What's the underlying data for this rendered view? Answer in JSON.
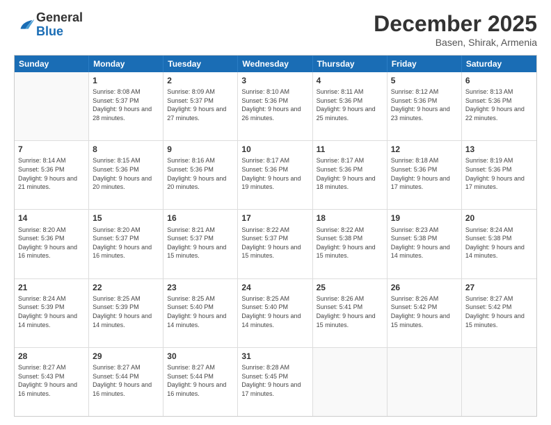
{
  "header": {
    "logo": {
      "general": "General",
      "blue": "Blue"
    },
    "title": "December 2025",
    "subtitle": "Basen, Shirak, Armenia"
  },
  "calendar": {
    "days": [
      "Sunday",
      "Monday",
      "Tuesday",
      "Wednesday",
      "Thursday",
      "Friday",
      "Saturday"
    ],
    "rows": [
      [
        {
          "day": "",
          "empty": true
        },
        {
          "day": "1",
          "sunrise": "8:08 AM",
          "sunset": "5:37 PM",
          "daylight": "9 hours and 28 minutes."
        },
        {
          "day": "2",
          "sunrise": "8:09 AM",
          "sunset": "5:37 PM",
          "daylight": "9 hours and 27 minutes."
        },
        {
          "day": "3",
          "sunrise": "8:10 AM",
          "sunset": "5:36 PM",
          "daylight": "9 hours and 26 minutes."
        },
        {
          "day": "4",
          "sunrise": "8:11 AM",
          "sunset": "5:36 PM",
          "daylight": "9 hours and 25 minutes."
        },
        {
          "day": "5",
          "sunrise": "8:12 AM",
          "sunset": "5:36 PM",
          "daylight": "9 hours and 23 minutes."
        },
        {
          "day": "6",
          "sunrise": "8:13 AM",
          "sunset": "5:36 PM",
          "daylight": "9 hours and 22 minutes."
        }
      ],
      [
        {
          "day": "7",
          "sunrise": "8:14 AM",
          "sunset": "5:36 PM",
          "daylight": "9 hours and 21 minutes."
        },
        {
          "day": "8",
          "sunrise": "8:15 AM",
          "sunset": "5:36 PM",
          "daylight": "9 hours and 20 minutes."
        },
        {
          "day": "9",
          "sunrise": "8:16 AM",
          "sunset": "5:36 PM",
          "daylight": "9 hours and 20 minutes."
        },
        {
          "day": "10",
          "sunrise": "8:17 AM",
          "sunset": "5:36 PM",
          "daylight": "9 hours and 19 minutes."
        },
        {
          "day": "11",
          "sunrise": "8:17 AM",
          "sunset": "5:36 PM",
          "daylight": "9 hours and 18 minutes."
        },
        {
          "day": "12",
          "sunrise": "8:18 AM",
          "sunset": "5:36 PM",
          "daylight": "9 hours and 17 minutes."
        },
        {
          "day": "13",
          "sunrise": "8:19 AM",
          "sunset": "5:36 PM",
          "daylight": "9 hours and 17 minutes."
        }
      ],
      [
        {
          "day": "14",
          "sunrise": "8:20 AM",
          "sunset": "5:36 PM",
          "daylight": "9 hours and 16 minutes."
        },
        {
          "day": "15",
          "sunrise": "8:20 AM",
          "sunset": "5:37 PM",
          "daylight": "9 hours and 16 minutes."
        },
        {
          "day": "16",
          "sunrise": "8:21 AM",
          "sunset": "5:37 PM",
          "daylight": "9 hours and 15 minutes."
        },
        {
          "day": "17",
          "sunrise": "8:22 AM",
          "sunset": "5:37 PM",
          "daylight": "9 hours and 15 minutes."
        },
        {
          "day": "18",
          "sunrise": "8:22 AM",
          "sunset": "5:38 PM",
          "daylight": "9 hours and 15 minutes."
        },
        {
          "day": "19",
          "sunrise": "8:23 AM",
          "sunset": "5:38 PM",
          "daylight": "9 hours and 14 minutes."
        },
        {
          "day": "20",
          "sunrise": "8:24 AM",
          "sunset": "5:38 PM",
          "daylight": "9 hours and 14 minutes."
        }
      ],
      [
        {
          "day": "21",
          "sunrise": "8:24 AM",
          "sunset": "5:39 PM",
          "daylight": "9 hours and 14 minutes."
        },
        {
          "day": "22",
          "sunrise": "8:25 AM",
          "sunset": "5:39 PM",
          "daylight": "9 hours and 14 minutes."
        },
        {
          "day": "23",
          "sunrise": "8:25 AM",
          "sunset": "5:40 PM",
          "daylight": "9 hours and 14 minutes."
        },
        {
          "day": "24",
          "sunrise": "8:25 AM",
          "sunset": "5:40 PM",
          "daylight": "9 hours and 14 minutes."
        },
        {
          "day": "25",
          "sunrise": "8:26 AM",
          "sunset": "5:41 PM",
          "daylight": "9 hours and 15 minutes."
        },
        {
          "day": "26",
          "sunrise": "8:26 AM",
          "sunset": "5:42 PM",
          "daylight": "9 hours and 15 minutes."
        },
        {
          "day": "27",
          "sunrise": "8:27 AM",
          "sunset": "5:42 PM",
          "daylight": "9 hours and 15 minutes."
        }
      ],
      [
        {
          "day": "28",
          "sunrise": "8:27 AM",
          "sunset": "5:43 PM",
          "daylight": "9 hours and 16 minutes."
        },
        {
          "day": "29",
          "sunrise": "8:27 AM",
          "sunset": "5:44 PM",
          "daylight": "9 hours and 16 minutes."
        },
        {
          "day": "30",
          "sunrise": "8:27 AM",
          "sunset": "5:44 PM",
          "daylight": "9 hours and 16 minutes."
        },
        {
          "day": "31",
          "sunrise": "8:28 AM",
          "sunset": "5:45 PM",
          "daylight": "9 hours and 17 minutes."
        },
        {
          "day": "",
          "empty": true
        },
        {
          "day": "",
          "empty": true
        },
        {
          "day": "",
          "empty": true
        }
      ]
    ]
  }
}
